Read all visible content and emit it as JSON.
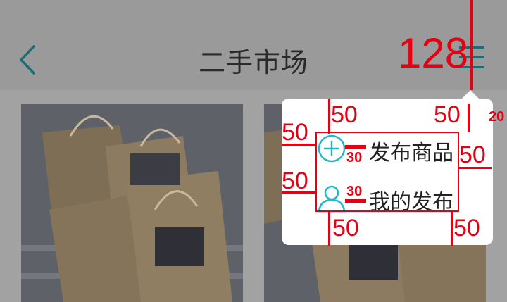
{
  "header": {
    "title": "二手市场",
    "back_icon": "chevron-left-icon",
    "menu_icon": "menu-icon"
  },
  "popup": {
    "items": [
      {
        "label": "发布商品",
        "icon": "plus-circle-icon"
      },
      {
        "label": "我的发布",
        "icon": "user-icon"
      }
    ]
  },
  "annotations": {
    "header_height": "128",
    "gap_top_left": "50",
    "gap_top_right": "50",
    "arrow_gap": "20",
    "pad_left_1": "50",
    "pad_left_2": "50",
    "pad_right": "50",
    "icon_gap_1": "30",
    "icon_gap_2": "30",
    "gap_bottom_left": "50",
    "gap_bottom_right": "50"
  },
  "colors": {
    "accent": "#1fb8c6",
    "annotation": "#e60012",
    "overlay": "#9b9b9b"
  }
}
